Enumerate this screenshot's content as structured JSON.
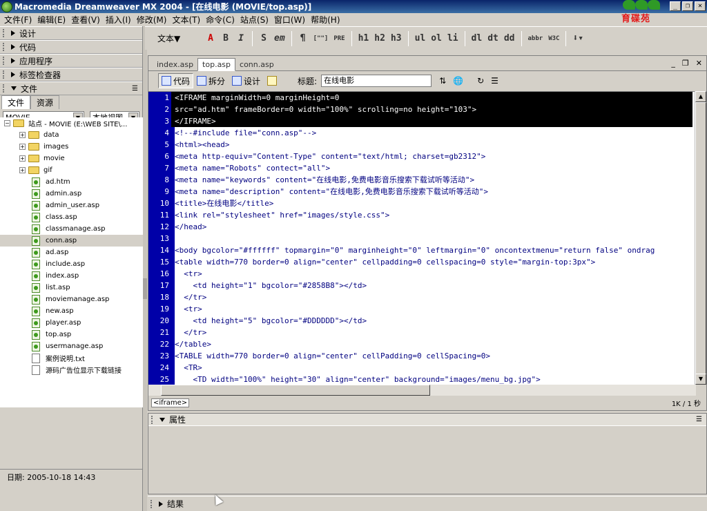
{
  "window": {
    "title": "Macromedia Dreamweaver MX 2004 - [在线电影 (MOVIE/top.asp)]",
    "logo_text": "育碟苑",
    "controls": [
      "_",
      "❐",
      "✕"
    ]
  },
  "menu": [
    "文件(F)",
    "编辑(E)",
    "查看(V)",
    "插入(I)",
    "修改(M)",
    "文本(T)",
    "命令(C)",
    "站点(S)",
    "窗口(W)",
    "帮助(H)"
  ],
  "insertbar": {
    "category": "文本▼",
    "buttons": [
      "A",
      "B",
      "I",
      "S",
      "em",
      "¶",
      "[\"\"]",
      "PRE",
      "h1",
      "h2",
      "h3",
      "ul",
      "ol",
      "li",
      "dl",
      "dt",
      "dd",
      "abbr",
      "W3C",
      "⬇▾"
    ]
  },
  "panels": {
    "design": "设计",
    "code": "代码",
    "app": "应用程序",
    "tag_inspector": "标签检查器",
    "files": "文件",
    "files_tabs": [
      "文件",
      "资源"
    ],
    "site_select": "MOVIE",
    "view_select": "本地视图"
  },
  "filetree": {
    "root": "站点 - MOVIE (E:\\WEB SITE\\...",
    "items": [
      {
        "type": "folder",
        "name": "data"
      },
      {
        "type": "folder",
        "name": "images"
      },
      {
        "type": "folder",
        "name": "movie"
      },
      {
        "type": "folder",
        "name": "gif"
      },
      {
        "type": "asp",
        "name": "ad.htm"
      },
      {
        "type": "asp",
        "name": "admin.asp"
      },
      {
        "type": "asp",
        "name": "admin_user.asp"
      },
      {
        "type": "asp",
        "name": "class.asp"
      },
      {
        "type": "asp",
        "name": "classmanage.asp"
      },
      {
        "type": "asp",
        "name": "conn.asp"
      },
      {
        "type": "asp",
        "name": "ad.asp"
      },
      {
        "type": "asp",
        "name": "include.asp"
      },
      {
        "type": "asp",
        "name": "index.asp"
      },
      {
        "type": "asp",
        "name": "list.asp"
      },
      {
        "type": "asp",
        "name": "moviemanage.asp"
      },
      {
        "type": "asp",
        "name": "new.asp"
      },
      {
        "type": "asp",
        "name": "player.asp"
      },
      {
        "type": "asp",
        "name": "top.asp"
      },
      {
        "type": "asp",
        "name": "usermanage.asp"
      },
      {
        "type": "txt",
        "name": "案例说明.txt"
      },
      {
        "type": "txt",
        "name": "源码广告位显示下载链接"
      }
    ]
  },
  "left_status": "日期: 2005-10-18 14:43",
  "document": {
    "tabs": [
      "index.asp",
      "top.asp",
      "conn.asp"
    ],
    "active_tab": 1,
    "view_buttons": [
      "代码",
      "拆分",
      "设计"
    ],
    "title_label": "标题:",
    "title_value": "在线电影",
    "tag_selector": "<iframe>",
    "size_info": "1K / 1 秒"
  },
  "code": [
    {
      "n": "1",
      "text": "<IFRAME marginWidth=0 marginHeight=0",
      "hl": true
    },
    {
      "n": "2",
      "text": "src=\"ad.htm\" frameBorder=0 width=\"100%\" scrolling=no height=\"103\">",
      "hl": true
    },
    {
      "n": "3",
      "text": "</IFRAME>",
      "hl": true
    },
    {
      "n": "4",
      "text": "<!--#include file=\"conn.asp\"-->",
      "hl": false
    },
    {
      "n": "5",
      "text": "<html><head>",
      "hl": false
    },
    {
      "n": "6",
      "text": "<meta http-equiv=\"Content-Type\" content=\"text/html; charset=gb2312\">",
      "hl": false
    },
    {
      "n": "7",
      "text": "<meta name=\"Robots\" contect=\"all\">",
      "hl": false
    },
    {
      "n": "8",
      "text": "<meta name=\"keywords\" content=\"在线电影,免费电影音乐搜索下载试听等活动\">",
      "hl": false
    },
    {
      "n": "9",
      "text": "<meta name=\"description\" content=\"在线电影,免费电影音乐搜索下载试听等活动\">",
      "hl": false
    },
    {
      "n": "10",
      "text": "<title>在线电影</title>",
      "hl": false
    },
    {
      "n": "11",
      "text": "<link rel=\"stylesheet\" href=\"images/style.css\">",
      "hl": false
    },
    {
      "n": "12",
      "text": "</head>",
      "hl": false
    },
    {
      "n": "13",
      "text": "",
      "hl": false
    },
    {
      "n": "14",
      "text": "<body bgcolor=\"#ffffff\" topmargin=\"0\" marginheight=\"0\" leftmargin=\"0\" oncontextmenu=\"return false\" ondrag",
      "hl": false
    },
    {
      "n": "15",
      "text": "<table width=770 border=0 align=\"center\" cellpadding=0 cellspacing=0 style=\"margin-top:3px\">",
      "hl": false
    },
    {
      "n": "16",
      "text": "  <tr>",
      "hl": false
    },
    {
      "n": "17",
      "text": "    <td height=\"1\" bgcolor=\"#2858B8\"></td>",
      "hl": false
    },
    {
      "n": "18",
      "text": "  </tr>",
      "hl": false
    },
    {
      "n": "19",
      "text": "  <tr>",
      "hl": false
    },
    {
      "n": "20",
      "text": "    <td height=\"5\" bgcolor=\"#DDDDDD\"></td>",
      "hl": false
    },
    {
      "n": "21",
      "text": "  </tr>",
      "hl": false
    },
    {
      "n": "22",
      "text": "</table>",
      "hl": false
    },
    {
      "n": "23",
      "text": "<TABLE width=770 border=0 align=\"center\" cellPadding=0 cellSpacing=0>",
      "hl": false
    },
    {
      "n": "24",
      "text": "  <TR>",
      "hl": false
    },
    {
      "n": "25",
      "text": "    <TD width=\"100%\" height=\"30\" align=\"center\" background=\"images/menu_bg.jpg\">",
      "hl": false
    }
  ],
  "properties_label": "属性",
  "results_label": "结果"
}
